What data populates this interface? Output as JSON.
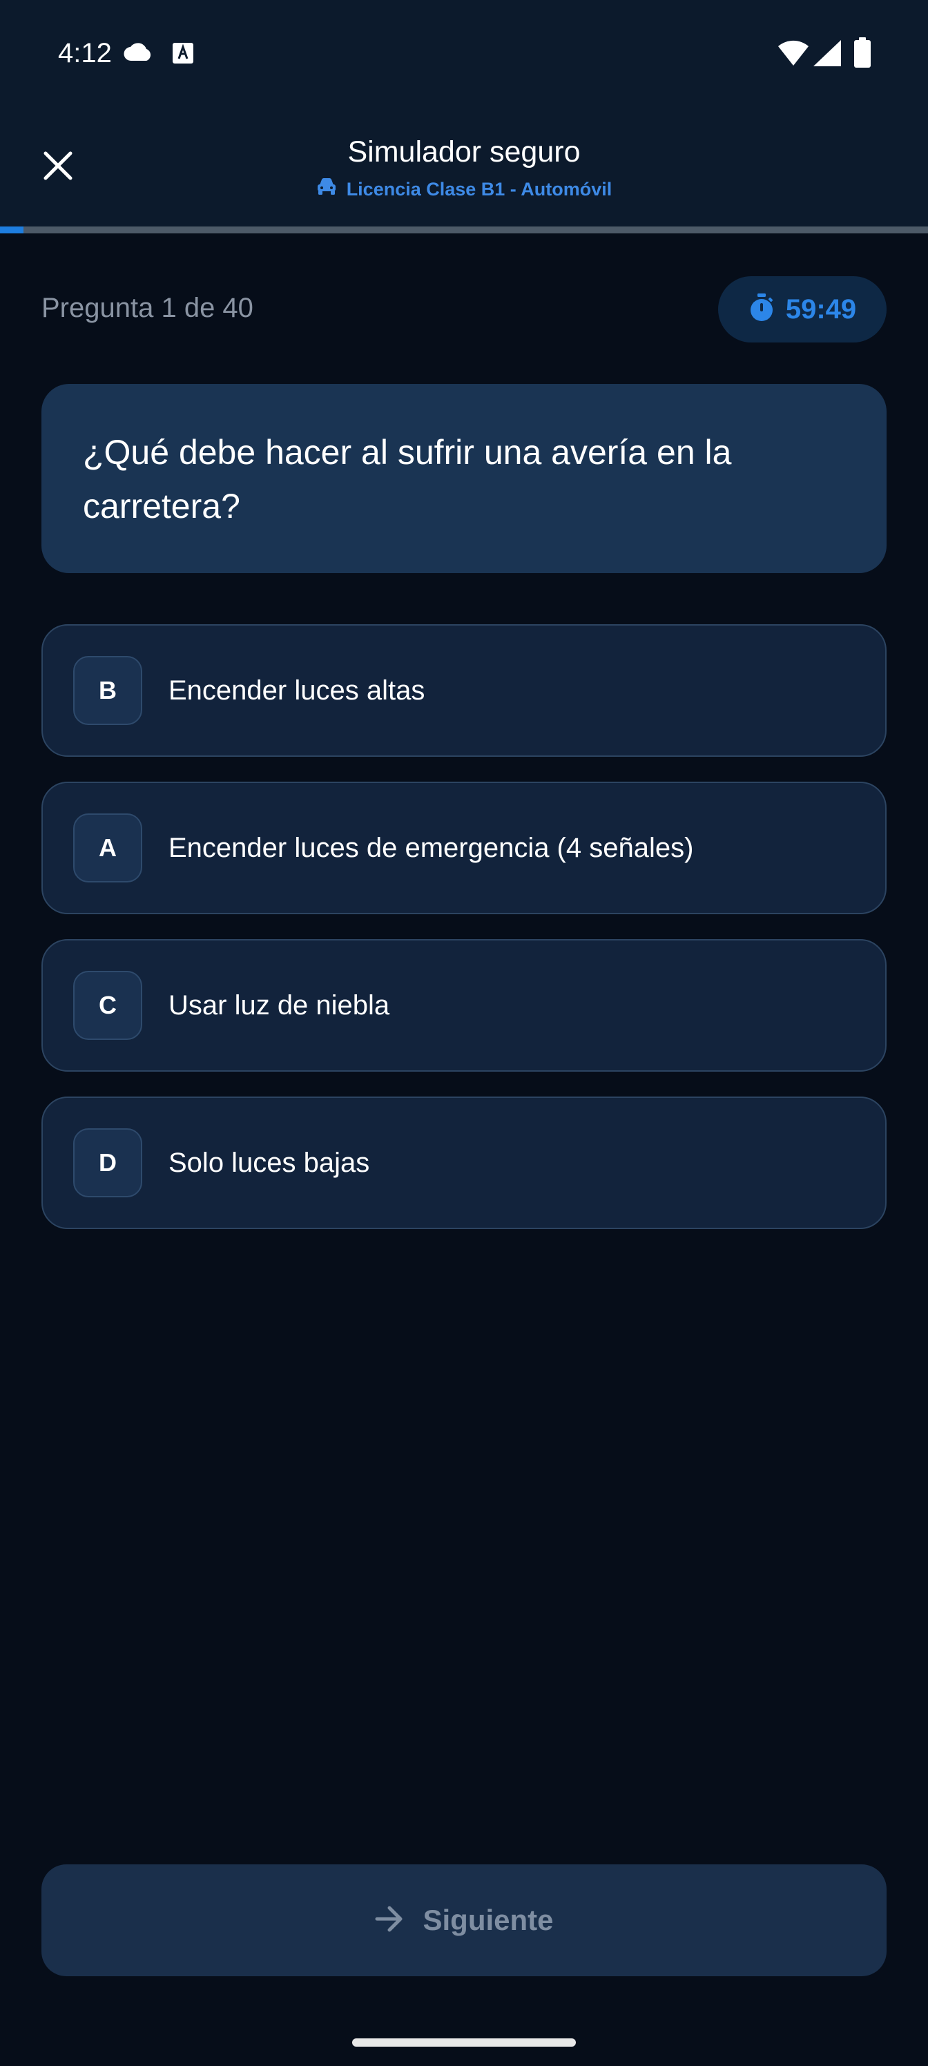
{
  "status_bar": {
    "time": "4:12",
    "icons": [
      "cloud-icon",
      "text-a-icon",
      "wifi-icon",
      "signal-icon",
      "battery-icon"
    ]
  },
  "header": {
    "title": "Simulador seguro",
    "subtitle": "Licencia Clase B1 - Automóvil",
    "close_icon": "close-icon",
    "subtitle_icon": "car-icon"
  },
  "progress": {
    "current": 1,
    "total": 40,
    "fraction": 0.025
  },
  "quiz": {
    "counter_label": "Pregunta 1 de 40",
    "timer": "59:49",
    "timer_icon": "stopwatch-icon",
    "question": "¿Qué debe hacer al sufrir una avería en la carretera?",
    "options": [
      {
        "letter": "B",
        "text": "Encender luces altas"
      },
      {
        "letter": "A",
        "text": "Encender luces de emergencia (4 señales)"
      },
      {
        "letter": "C",
        "text": "Usar luz de niebla"
      },
      {
        "letter": "D",
        "text": "Solo luces bajas"
      }
    ]
  },
  "footer": {
    "next_label": "Siguiente",
    "next_icon": "arrow-right-icon"
  },
  "colors": {
    "background": "#060d19",
    "header_bg": "#0c1a2c",
    "accent": "#1e7ee0",
    "card": "#1a3453",
    "option_bg": "#12233c"
  }
}
